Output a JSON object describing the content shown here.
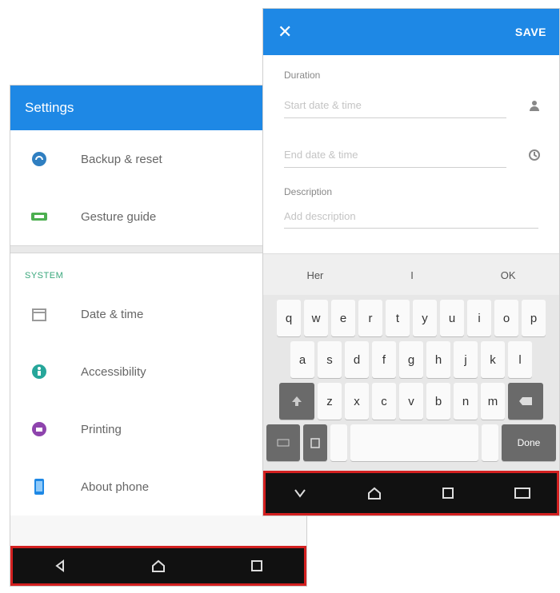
{
  "left": {
    "header_title": "Settings",
    "top_items": [
      {
        "label": "Backup & reset",
        "icon": "backup-icon"
      },
      {
        "label": "Gesture guide",
        "icon": "gesture-icon"
      }
    ],
    "section_title": "SYSTEM",
    "system_items": [
      {
        "label": "Date & time",
        "icon": "calendar-icon"
      },
      {
        "label": "Accessibility",
        "icon": "accessibility-icon"
      },
      {
        "label": "Printing",
        "icon": "print-icon"
      },
      {
        "label": "About phone",
        "icon": "phone-icon"
      }
    ]
  },
  "right": {
    "close_label": "✕",
    "save_label": "SAVE",
    "fields": {
      "duration_label": "Duration",
      "start_placeholder": "Start date & time",
      "end_placeholder": "End date & time",
      "description_label": "Description",
      "description_placeholder": "Add description"
    },
    "suggestions": [
      "Her",
      "I",
      "OK"
    ],
    "keyboard": {
      "row1": [
        "q",
        "w",
        "e",
        "r",
        "t",
        "y",
        "u",
        "i",
        "o",
        "p"
      ],
      "row2": [
        "a",
        "s",
        "d",
        "f",
        "g",
        "h",
        "j",
        "k",
        "l"
      ],
      "row3": [
        "z",
        "x",
        "c",
        "v",
        "b",
        "n",
        "m"
      ],
      "enter_label": "Done"
    }
  },
  "colors": {
    "header_blue": "#1e88e5",
    "highlight_red": "#d32020",
    "section_green": "#3aa77c"
  }
}
